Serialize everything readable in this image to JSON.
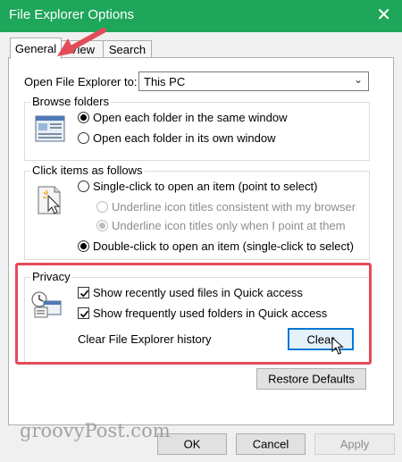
{
  "window": {
    "title": "File Explorer Options",
    "close_glyph": "✕"
  },
  "tabs": [
    {
      "label": "General",
      "active": true
    },
    {
      "label": "View",
      "active": false
    },
    {
      "label": "Search",
      "active": false
    }
  ],
  "open_to": {
    "label": "Open File Explorer to:",
    "value": "This PC"
  },
  "browse_folders": {
    "legend": "Browse folders",
    "options": [
      "Open each folder in the same window",
      "Open each folder in its own window"
    ],
    "selected": 0
  },
  "click_items": {
    "legend": "Click items as follows",
    "single": "Single-click to open an item (point to select)",
    "underline_browser": "Underline icon titles consistent with my browser",
    "underline_point": "Underline icon titles only when I point at them",
    "double": "Double-click to open an item (single-click to select)",
    "selected": "double"
  },
  "privacy": {
    "legend": "Privacy",
    "show_recent_files": "Show recently used files in Quick access",
    "show_frequent_folders": "Show frequently used folders in Quick access",
    "clear_history_label": "Clear File Explorer history",
    "clear_button": "Clear"
  },
  "restore_defaults": "Restore Defaults",
  "footer": {
    "ok": "OK",
    "cancel": "Cancel",
    "apply": "Apply"
  },
  "watermark": "groovyPost.com",
  "colors": {
    "titlebar": "#1ea65a",
    "annotation": "#e34b58",
    "focus": "#0078d7"
  }
}
